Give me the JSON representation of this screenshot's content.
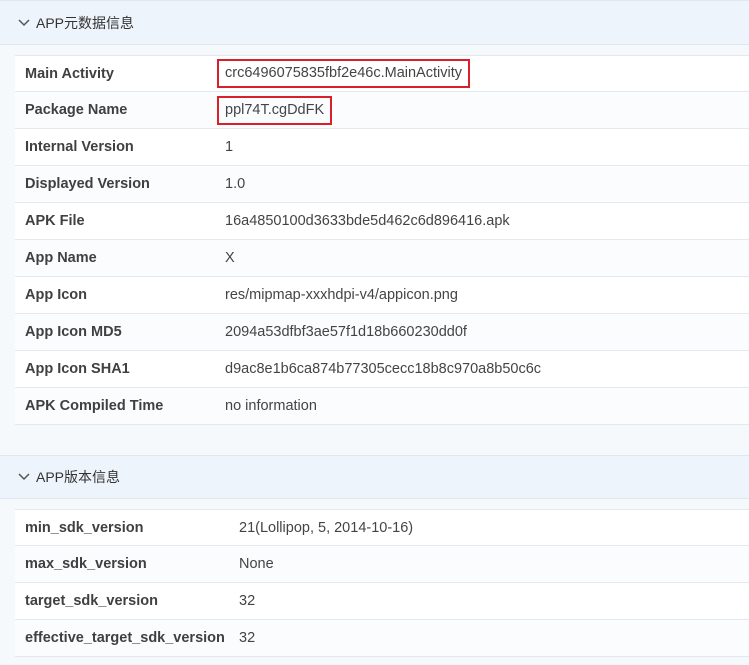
{
  "app_meta_section": {
    "title": "APP元数据信息",
    "rows": [
      {
        "key": "Main Activity",
        "value": "crc6496075835fbf2e46c.MainActivity",
        "highlighted": true
      },
      {
        "key": "Package Name",
        "value": "ppl74T.cgDdFK",
        "highlighted": true
      },
      {
        "key": "Internal Version",
        "value": "1"
      },
      {
        "key": "Displayed Version",
        "value": "1.0"
      },
      {
        "key": "APK File",
        "value": "16a4850100d3633bde5d462c6d896416.apk"
      },
      {
        "key": "App Name",
        "value": "X"
      },
      {
        "key": "App Icon",
        "value": "res/mipmap-xxxhdpi-v4/appicon.png"
      },
      {
        "key": "App Icon MD5",
        "value": "2094a53dfbf3ae57f1d18b660230dd0f"
      },
      {
        "key": "App Icon SHA1",
        "value": "d9ac8e1b6ca874b77305cecc18b8c970a8b50c6c"
      },
      {
        "key": "APK Compiled Time",
        "value": "no information"
      }
    ]
  },
  "app_version_section": {
    "title": "APP版本信息",
    "rows": [
      {
        "key": "min_sdk_version",
        "value": "21(Lollipop, 5, 2014-10-16)"
      },
      {
        "key": "max_sdk_version",
        "value": "None"
      },
      {
        "key": "target_sdk_version",
        "value": "32"
      },
      {
        "key": "effective_target_sdk_version",
        "value": "32"
      }
    ]
  },
  "colors": {
    "header_bg": "#eef4fb",
    "highlight_border": "#d9202a"
  }
}
